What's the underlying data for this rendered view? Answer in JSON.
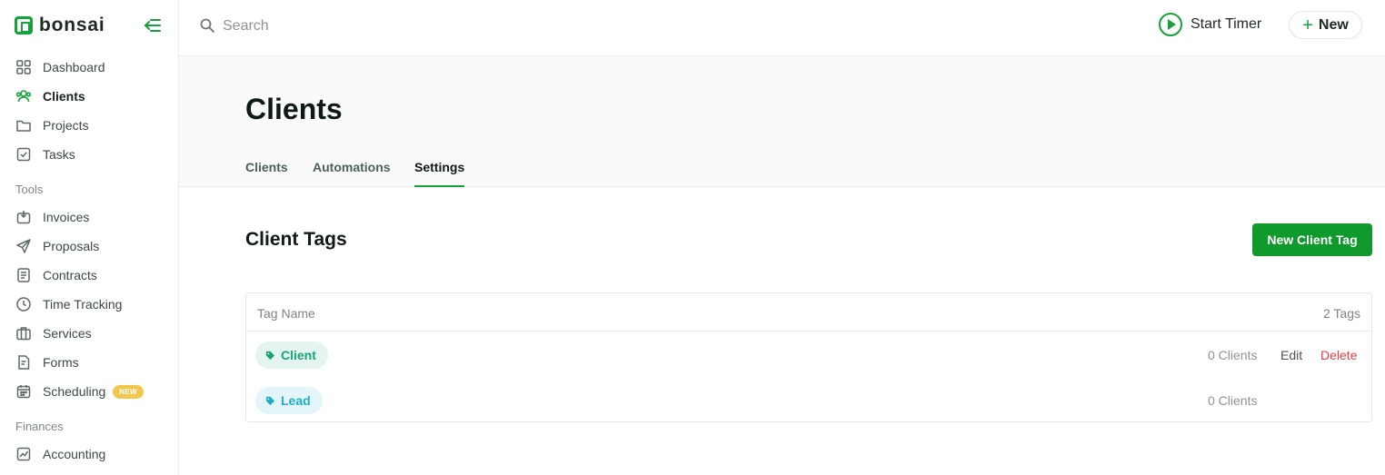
{
  "app": {
    "logo_text": "bonsai"
  },
  "sidebar": {
    "items": [
      {
        "label": "Dashboard",
        "icon": "grid-icon"
      },
      {
        "label": "Clients",
        "icon": "users-icon",
        "active": true
      },
      {
        "label": "Projects",
        "icon": "folder-icon"
      },
      {
        "label": "Tasks",
        "icon": "checkbox-icon"
      }
    ],
    "tools_label": "Tools",
    "tools": [
      {
        "label": "Invoices",
        "icon": "invoice-icon"
      },
      {
        "label": "Proposals",
        "icon": "send-icon"
      },
      {
        "label": "Contracts",
        "icon": "document-icon"
      },
      {
        "label": "Time Tracking",
        "icon": "clock-icon"
      },
      {
        "label": "Services",
        "icon": "briefcase-icon"
      },
      {
        "label": "Forms",
        "icon": "form-icon"
      },
      {
        "label": "Scheduling",
        "icon": "calendar-icon",
        "badge": "NEW"
      }
    ],
    "finances_label": "Finances",
    "finances": [
      {
        "label": "Accounting",
        "icon": "chart-icon"
      }
    ]
  },
  "topbar": {
    "search_placeholder": "Search",
    "start_timer_label": "Start Timer",
    "new_label": "New"
  },
  "page": {
    "title": "Clients",
    "tabs": [
      {
        "label": "Clients"
      },
      {
        "label": "Automations"
      },
      {
        "label": "Settings",
        "active": true
      }
    ]
  },
  "client_tags": {
    "title": "Client Tags",
    "new_button_label": "New Client Tag",
    "header_name": "Tag Name",
    "header_count": "2 Tags",
    "rows": [
      {
        "name": "Client",
        "count": "0 Clients",
        "edit": "Edit",
        "delete": "Delete"
      },
      {
        "name": "Lead",
        "count": "0 Clients"
      }
    ]
  },
  "colors": {
    "brand_green": "#14a33a",
    "button_green": "#109a2c",
    "delete_red": "#ea3d3d",
    "badge_yellow": "#f1c84b",
    "tag_client_text": "#19a37a",
    "tag_lead_text": "#20aec7"
  }
}
